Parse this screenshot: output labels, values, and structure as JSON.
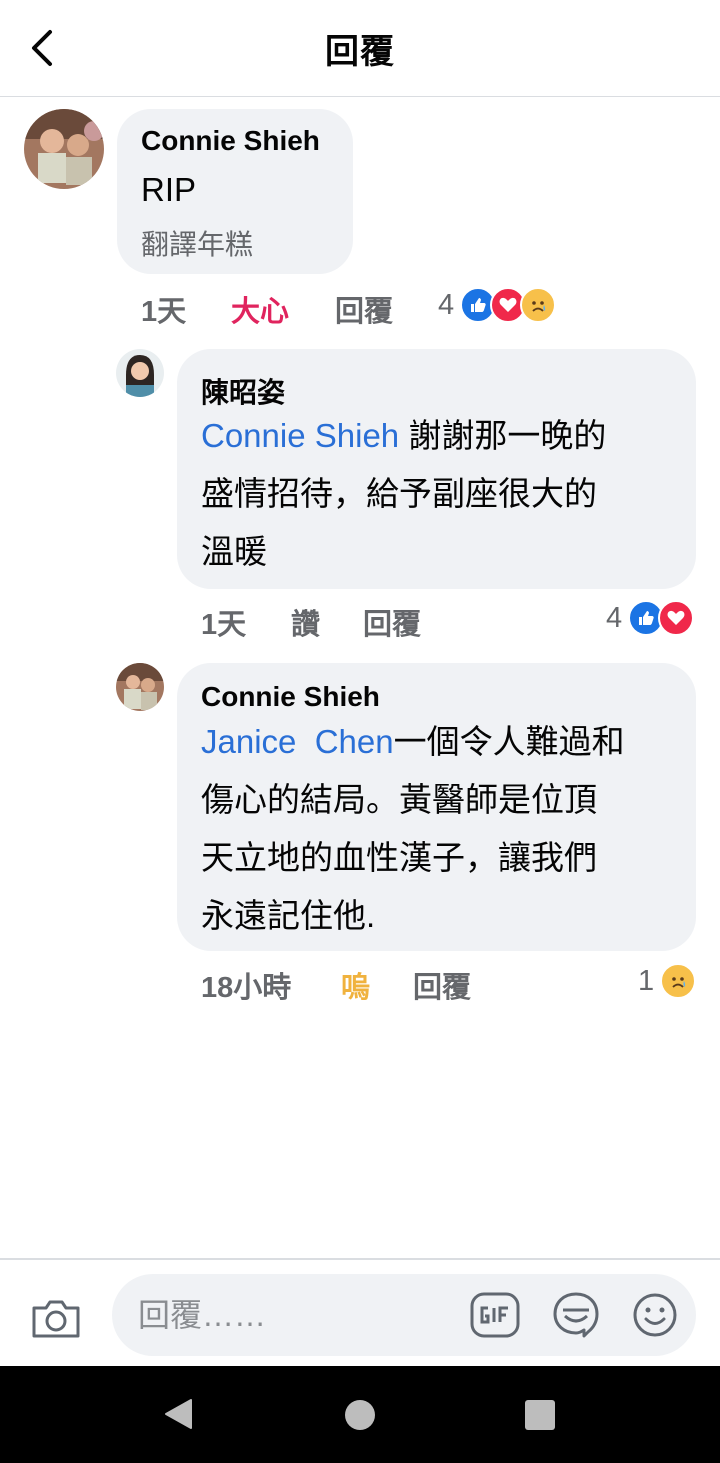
{
  "header": {
    "title": "回覆"
  },
  "comments": [
    {
      "author": "Connie Shieh",
      "text": "RIP",
      "translate": "翻譯年糕",
      "time": "1天",
      "reaction": "大心",
      "reply": "回覆",
      "reaction_count": "4",
      "reaction_types": [
        "like-icon",
        "love-icon",
        "sad-icon"
      ]
    },
    {
      "author": "陳昭姿",
      "mention": "Connie Shieh",
      "text_lines": [
        " 謝謝那一晚的",
        "盛情招待，給予副座很大的",
        "溫暖"
      ],
      "time": "1天",
      "reaction": "讚",
      "reply": "回覆",
      "reaction_count": "4",
      "reaction_types": [
        "like-icon",
        "love-icon"
      ]
    },
    {
      "author": "Connie Shieh",
      "mention": "Janice  Chen",
      "text_lines": [
        "一個令人難過和",
        "傷心的結局。黃醫師是位頂",
        "天立地的血性漢子，讓我們",
        "永遠記住他."
      ],
      "time": "18小時",
      "reaction": "嗚",
      "reply": "回覆",
      "reaction_count": "1",
      "reaction_types": [
        "sad-icon"
      ]
    }
  ],
  "composer": {
    "placeholder": "回覆……"
  },
  "colors": {
    "mention": "#2a6fd6",
    "love": "#e0245e",
    "sad": "#f0b23e",
    "bubble": "#f0f2f5",
    "meta": "#65676b"
  }
}
